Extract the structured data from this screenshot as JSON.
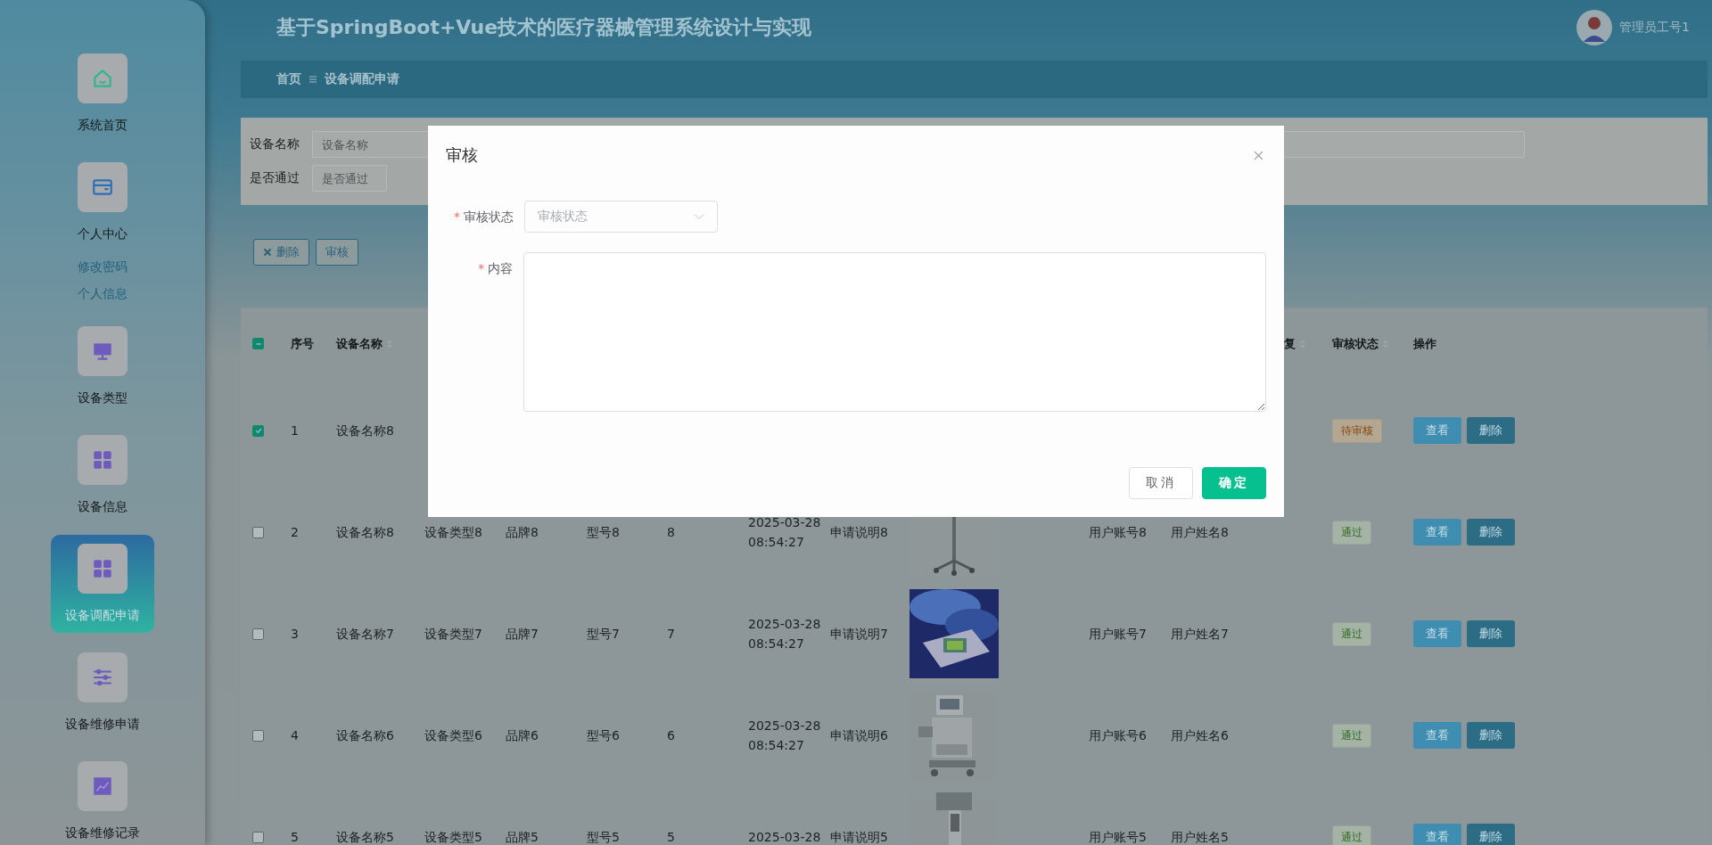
{
  "header": {
    "title": "基于SpringBoot+Vue技术的医疗器械管理系统设计与实现",
    "user": "管理员工号1"
  },
  "sidebar": {
    "items": [
      {
        "label": "系统首页",
        "selected": false
      },
      {
        "label": "个人中心",
        "selected": false,
        "children": [
          {
            "label": "修改密码"
          },
          {
            "label": "个人信息"
          }
        ]
      },
      {
        "label": "设备类型",
        "selected": false
      },
      {
        "label": "设备信息",
        "selected": false
      },
      {
        "label": "设备调配申请",
        "selected": true
      },
      {
        "label": "设备维修申请",
        "selected": false
      },
      {
        "label": "设备维修记录",
        "selected": false
      }
    ]
  },
  "breadcrumb": [
    "首页",
    "设备调配申请"
  ],
  "search": {
    "fields": [
      {
        "label": "设备名称",
        "placeholder": "设备名称"
      },
      {
        "label": "是否通过",
        "placeholder": "是否通过"
      }
    ]
  },
  "toolbar": [
    {
      "label": "删除"
    },
    {
      "label": "审核"
    }
  ],
  "table": {
    "select_all": {
      "indeterminate": true
    },
    "columns": [
      {
        "label": "序号",
        "sortable": false
      },
      {
        "label": "设备名称",
        "sortable": true
      },
      {
        "label": "复",
        "sortable": true
      },
      {
        "label": "审核状态",
        "sortable": true
      },
      {
        "label": "操作",
        "sortable": false
      }
    ],
    "rows": [
      {
        "checked": true,
        "index": "1",
        "name": "设备名称8",
        "status": {
          "text": "待审核",
          "kind": "warning"
        },
        "actions": [
          "查看",
          "删除"
        ]
      },
      {
        "checked": false,
        "index": "2",
        "name": "设备名称8",
        "type": "设备类型8",
        "brand": "品牌8",
        "model": "型号8",
        "quantity": "8",
        "datetime": [
          "2025-03-28",
          "08:54:27"
        ],
        "note": "申请说明8",
        "image": {
          "kind": "picture"
        },
        "account": "用户账号8",
        "username": "用户姓名8",
        "status": {
          "text": "通过",
          "kind": "success"
        },
        "actions": [
          "查看",
          "删除"
        ]
      },
      {
        "checked": false,
        "index": "3",
        "name": "设备名称7",
        "type": "设备类型7",
        "brand": "品牌7",
        "model": "型号7",
        "quantity": "7",
        "datetime": [
          "2025-03-28",
          "08:54:27"
        ],
        "note": "申请说明7",
        "image": {
          "kind": "picture"
        },
        "account": "用户账号7",
        "username": "用户姓名7",
        "status": {
          "text": "通过",
          "kind": "success"
        },
        "actions": [
          "查看",
          "删除"
        ]
      },
      {
        "checked": false,
        "index": "4",
        "name": "设备名称6",
        "type": "设备类型6",
        "brand": "品牌6",
        "model": "型号6",
        "quantity": "6",
        "datetime": [
          "2025-03-28",
          "08:54:27"
        ],
        "note": "申请说明6",
        "image": {
          "kind": "picture"
        },
        "account": "用户账号6",
        "username": "用户姓名6",
        "status": {
          "text": "通过",
          "kind": "success"
        },
        "actions": [
          "查看",
          "删除"
        ]
      },
      {
        "checked": false,
        "index": "5",
        "name": "设备名称5",
        "type": "设备类型5",
        "brand": "品牌5",
        "model": "型号5",
        "quantity": "5",
        "datetime": [
          "2025-03-28"
        ],
        "note": "申请说明5",
        "image": {
          "kind": "picture"
        },
        "account": "用户账号5",
        "username": "用户姓名5",
        "status": {
          "text": "通过",
          "kind": "success"
        },
        "actions": [
          "查看",
          "删除"
        ]
      }
    ]
  },
  "dialog": {
    "title": "审核",
    "fields": [
      {
        "label": "审核状态",
        "required_mark": "*",
        "kind": "select",
        "placeholder": "审核状态"
      },
      {
        "label": "内容",
        "required_mark": "*",
        "kind": "textarea"
      }
    ],
    "buttons": [
      {
        "label": "取消",
        "kind": "default"
      },
      {
        "label": "确定",
        "kind": "primary"
      }
    ]
  }
}
